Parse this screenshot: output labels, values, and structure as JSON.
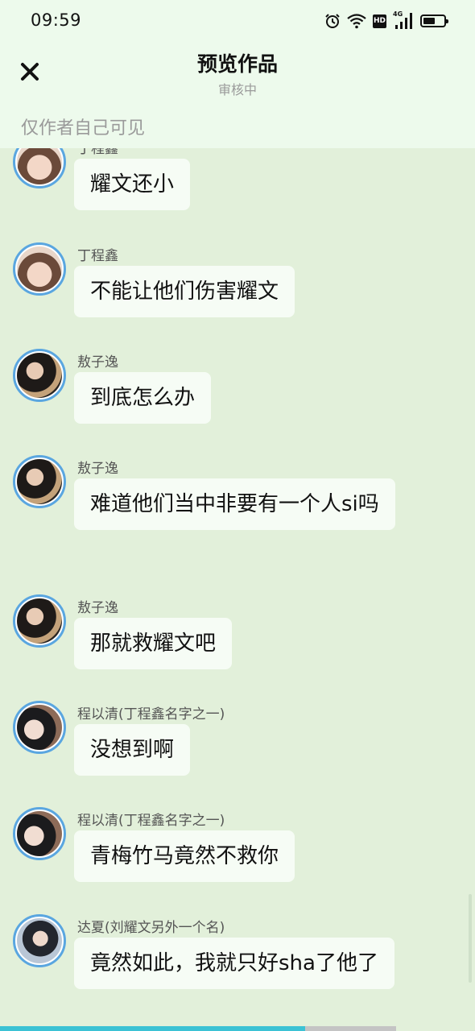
{
  "status_bar": {
    "time": "09:59",
    "icons": [
      "alarm-icon",
      "wifi-icon",
      "hd-icon",
      "signal-4g-icon",
      "battery-icon"
    ],
    "hd_label": "HD",
    "network_label": "4G"
  },
  "header": {
    "title": "预览作品",
    "subtitle": "审核中",
    "visibility_note": "仅作者自己可见"
  },
  "messages": [
    {
      "sender": "丁程鑫",
      "text": "耀文还小",
      "avatar": "ding"
    },
    {
      "sender": "丁程鑫",
      "text": "不能让他们伤害耀文",
      "avatar": "ding"
    },
    {
      "sender": "敖子逸",
      "text": "到底怎么办",
      "avatar": "ao"
    },
    {
      "sender": "敖子逸",
      "text": "难道他们当中非要有一个人si吗",
      "avatar": "ao"
    },
    {
      "sender": "敖子逸",
      "text": "那就救耀文吧",
      "avatar": "ao"
    },
    {
      "sender": "程以清(丁程鑫名字之一)",
      "text": "没想到啊",
      "avatar": "cheng"
    },
    {
      "sender": "程以清(丁程鑫名字之一)",
      "text": "青梅竹马竟然不救你",
      "avatar": "cheng"
    },
    {
      "sender": "达夏(刘耀文另外一个名)",
      "text": "竟然如此，我就只好sha了他了",
      "avatar": "da"
    }
  ],
  "progress": {
    "fraction": 0.77,
    "fill_color": "#3bc2d4"
  },
  "colors": {
    "background": "#e2f0da",
    "header_background": "#edfaec",
    "bubble": "#f6fcf5",
    "avatar_border": "#5aa6e0"
  }
}
